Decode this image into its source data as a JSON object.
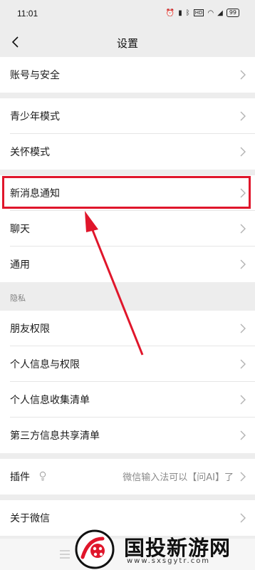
{
  "status_bar": {
    "time": "11:01",
    "battery": "99"
  },
  "nav": {
    "title": "设置"
  },
  "groups": {
    "account": {
      "label": "账号与安全"
    },
    "modes": [
      {
        "label": "青少年模式"
      },
      {
        "label": "关怀模式"
      }
    ],
    "general": [
      {
        "label": "新消息通知"
      },
      {
        "label": "聊天"
      },
      {
        "label": "通用"
      }
    ],
    "privacy": {
      "section_label": "隐私",
      "items": [
        {
          "label": "朋友权限"
        },
        {
          "label": "个人信息与权限"
        },
        {
          "label": "个人信息收集清单"
        },
        {
          "label": "第三方信息共享清单"
        }
      ]
    },
    "plugins": {
      "label": "插件",
      "value": "微信输入法可以【问AI】了"
    },
    "about": {
      "label": "关于微信"
    }
  },
  "annotation": {
    "highlight_color": "#e0162b",
    "highlighted_item": "新消息通知"
  },
  "watermark": {
    "title": "国投新游网",
    "url": "www.sxsgytr.com"
  }
}
